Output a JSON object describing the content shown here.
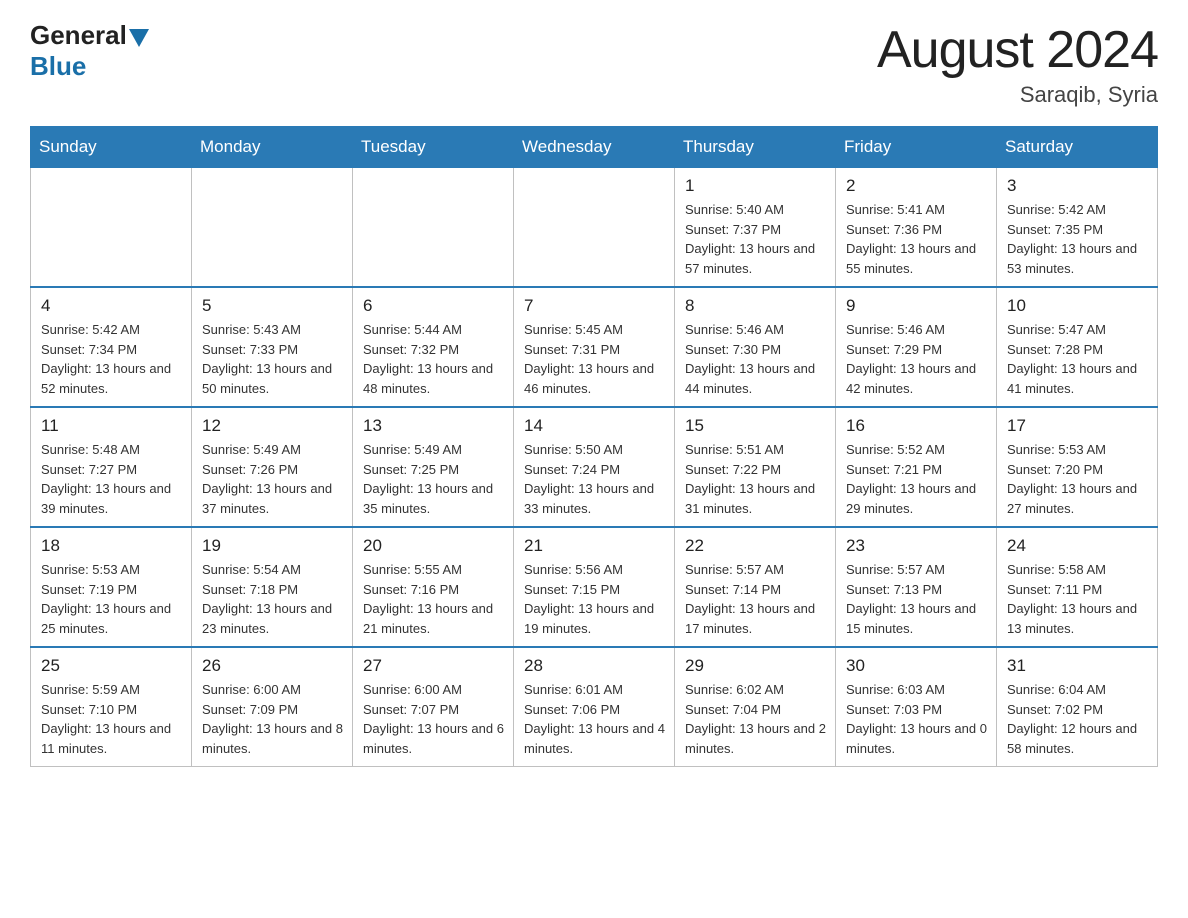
{
  "header": {
    "logo_general": "General",
    "logo_blue": "Blue",
    "month_title": "August 2024",
    "location": "Saraqib, Syria"
  },
  "days_of_week": [
    "Sunday",
    "Monday",
    "Tuesday",
    "Wednesday",
    "Thursday",
    "Friday",
    "Saturday"
  ],
  "weeks": [
    [
      {
        "day": "",
        "sunrise": "",
        "sunset": "",
        "daylight": "",
        "empty": true
      },
      {
        "day": "",
        "sunrise": "",
        "sunset": "",
        "daylight": "",
        "empty": true
      },
      {
        "day": "",
        "sunrise": "",
        "sunset": "",
        "daylight": "",
        "empty": true
      },
      {
        "day": "",
        "sunrise": "",
        "sunset": "",
        "daylight": "",
        "empty": true
      },
      {
        "day": "1",
        "sunrise": "Sunrise: 5:40 AM",
        "sunset": "Sunset: 7:37 PM",
        "daylight": "Daylight: 13 hours and 57 minutes.",
        "empty": false
      },
      {
        "day": "2",
        "sunrise": "Sunrise: 5:41 AM",
        "sunset": "Sunset: 7:36 PM",
        "daylight": "Daylight: 13 hours and 55 minutes.",
        "empty": false
      },
      {
        "day": "3",
        "sunrise": "Sunrise: 5:42 AM",
        "sunset": "Sunset: 7:35 PM",
        "daylight": "Daylight: 13 hours and 53 minutes.",
        "empty": false
      }
    ],
    [
      {
        "day": "4",
        "sunrise": "Sunrise: 5:42 AM",
        "sunset": "Sunset: 7:34 PM",
        "daylight": "Daylight: 13 hours and 52 minutes.",
        "empty": false
      },
      {
        "day": "5",
        "sunrise": "Sunrise: 5:43 AM",
        "sunset": "Sunset: 7:33 PM",
        "daylight": "Daylight: 13 hours and 50 minutes.",
        "empty": false
      },
      {
        "day": "6",
        "sunrise": "Sunrise: 5:44 AM",
        "sunset": "Sunset: 7:32 PM",
        "daylight": "Daylight: 13 hours and 48 minutes.",
        "empty": false
      },
      {
        "day": "7",
        "sunrise": "Sunrise: 5:45 AM",
        "sunset": "Sunset: 7:31 PM",
        "daylight": "Daylight: 13 hours and 46 minutes.",
        "empty": false
      },
      {
        "day": "8",
        "sunrise": "Sunrise: 5:46 AM",
        "sunset": "Sunset: 7:30 PM",
        "daylight": "Daylight: 13 hours and 44 minutes.",
        "empty": false
      },
      {
        "day": "9",
        "sunrise": "Sunrise: 5:46 AM",
        "sunset": "Sunset: 7:29 PM",
        "daylight": "Daylight: 13 hours and 42 minutes.",
        "empty": false
      },
      {
        "day": "10",
        "sunrise": "Sunrise: 5:47 AM",
        "sunset": "Sunset: 7:28 PM",
        "daylight": "Daylight: 13 hours and 41 minutes.",
        "empty": false
      }
    ],
    [
      {
        "day": "11",
        "sunrise": "Sunrise: 5:48 AM",
        "sunset": "Sunset: 7:27 PM",
        "daylight": "Daylight: 13 hours and 39 minutes.",
        "empty": false
      },
      {
        "day": "12",
        "sunrise": "Sunrise: 5:49 AM",
        "sunset": "Sunset: 7:26 PM",
        "daylight": "Daylight: 13 hours and 37 minutes.",
        "empty": false
      },
      {
        "day": "13",
        "sunrise": "Sunrise: 5:49 AM",
        "sunset": "Sunset: 7:25 PM",
        "daylight": "Daylight: 13 hours and 35 minutes.",
        "empty": false
      },
      {
        "day": "14",
        "sunrise": "Sunrise: 5:50 AM",
        "sunset": "Sunset: 7:24 PM",
        "daylight": "Daylight: 13 hours and 33 minutes.",
        "empty": false
      },
      {
        "day": "15",
        "sunrise": "Sunrise: 5:51 AM",
        "sunset": "Sunset: 7:22 PM",
        "daylight": "Daylight: 13 hours and 31 minutes.",
        "empty": false
      },
      {
        "day": "16",
        "sunrise": "Sunrise: 5:52 AM",
        "sunset": "Sunset: 7:21 PM",
        "daylight": "Daylight: 13 hours and 29 minutes.",
        "empty": false
      },
      {
        "day": "17",
        "sunrise": "Sunrise: 5:53 AM",
        "sunset": "Sunset: 7:20 PM",
        "daylight": "Daylight: 13 hours and 27 minutes.",
        "empty": false
      }
    ],
    [
      {
        "day": "18",
        "sunrise": "Sunrise: 5:53 AM",
        "sunset": "Sunset: 7:19 PM",
        "daylight": "Daylight: 13 hours and 25 minutes.",
        "empty": false
      },
      {
        "day": "19",
        "sunrise": "Sunrise: 5:54 AM",
        "sunset": "Sunset: 7:18 PM",
        "daylight": "Daylight: 13 hours and 23 minutes.",
        "empty": false
      },
      {
        "day": "20",
        "sunrise": "Sunrise: 5:55 AM",
        "sunset": "Sunset: 7:16 PM",
        "daylight": "Daylight: 13 hours and 21 minutes.",
        "empty": false
      },
      {
        "day": "21",
        "sunrise": "Sunrise: 5:56 AM",
        "sunset": "Sunset: 7:15 PM",
        "daylight": "Daylight: 13 hours and 19 minutes.",
        "empty": false
      },
      {
        "day": "22",
        "sunrise": "Sunrise: 5:57 AM",
        "sunset": "Sunset: 7:14 PM",
        "daylight": "Daylight: 13 hours and 17 minutes.",
        "empty": false
      },
      {
        "day": "23",
        "sunrise": "Sunrise: 5:57 AM",
        "sunset": "Sunset: 7:13 PM",
        "daylight": "Daylight: 13 hours and 15 minutes.",
        "empty": false
      },
      {
        "day": "24",
        "sunrise": "Sunrise: 5:58 AM",
        "sunset": "Sunset: 7:11 PM",
        "daylight": "Daylight: 13 hours and 13 minutes.",
        "empty": false
      }
    ],
    [
      {
        "day": "25",
        "sunrise": "Sunrise: 5:59 AM",
        "sunset": "Sunset: 7:10 PM",
        "daylight": "Daylight: 13 hours and 11 minutes.",
        "empty": false
      },
      {
        "day": "26",
        "sunrise": "Sunrise: 6:00 AM",
        "sunset": "Sunset: 7:09 PM",
        "daylight": "Daylight: 13 hours and 8 minutes.",
        "empty": false
      },
      {
        "day": "27",
        "sunrise": "Sunrise: 6:00 AM",
        "sunset": "Sunset: 7:07 PM",
        "daylight": "Daylight: 13 hours and 6 minutes.",
        "empty": false
      },
      {
        "day": "28",
        "sunrise": "Sunrise: 6:01 AM",
        "sunset": "Sunset: 7:06 PM",
        "daylight": "Daylight: 13 hours and 4 minutes.",
        "empty": false
      },
      {
        "day": "29",
        "sunrise": "Sunrise: 6:02 AM",
        "sunset": "Sunset: 7:04 PM",
        "daylight": "Daylight: 13 hours and 2 minutes.",
        "empty": false
      },
      {
        "day": "30",
        "sunrise": "Sunrise: 6:03 AM",
        "sunset": "Sunset: 7:03 PM",
        "daylight": "Daylight: 13 hours and 0 minutes.",
        "empty": false
      },
      {
        "day": "31",
        "sunrise": "Sunrise: 6:04 AM",
        "sunset": "Sunset: 7:02 PM",
        "daylight": "Daylight: 12 hours and 58 minutes.",
        "empty": false
      }
    ]
  ]
}
